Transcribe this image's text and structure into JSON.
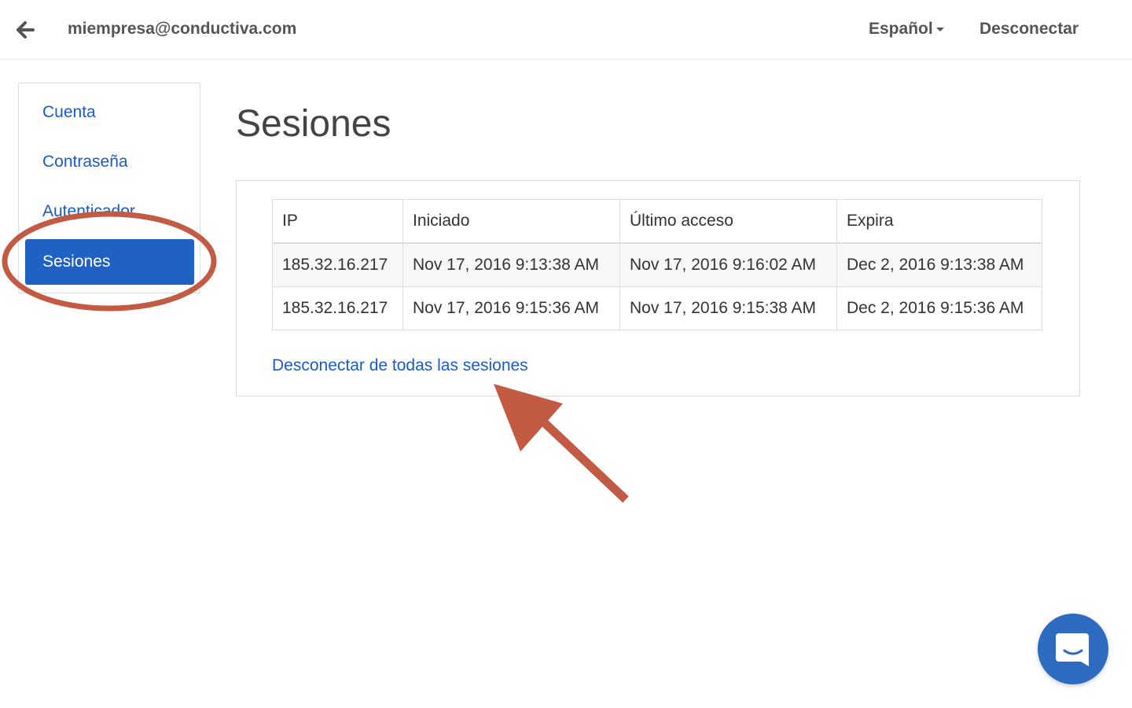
{
  "topbar": {
    "back_icon": "arrow-left-icon",
    "email": "miempresa@conductiva.com",
    "language": "Español",
    "logout": "Desconectar"
  },
  "sidebar": {
    "items": [
      {
        "label": "Cuenta",
        "active": false
      },
      {
        "label": "Contraseña",
        "active": false
      },
      {
        "label": "Autenticador",
        "active": false
      },
      {
        "label": "Sesiones",
        "active": true
      }
    ]
  },
  "main": {
    "title": "Sesiones",
    "table": {
      "headers": [
        "IP",
        "Iniciado",
        "Último acceso",
        "Expira"
      ],
      "rows": [
        [
          "185.32.16.217",
          "Nov 17, 2016 9:13:38 AM",
          "Nov 17, 2016 9:16:02 AM",
          "Dec 2, 2016 9:13:38 AM"
        ],
        [
          "185.32.16.217",
          "Nov 17, 2016 9:15:36 AM",
          "Nov 17, 2016 9:15:38 AM",
          "Dec 2, 2016 9:15:36 AM"
        ]
      ]
    },
    "disconnect_all": "Desconectar de todas las sesiones"
  },
  "chat": {
    "icon": "chat-bubble-icon"
  },
  "colors": {
    "link": "#1a5bc6",
    "active_nav": "#1f62c4",
    "annotation": "#c35a44",
    "chat_button": "#2d6cc0"
  }
}
